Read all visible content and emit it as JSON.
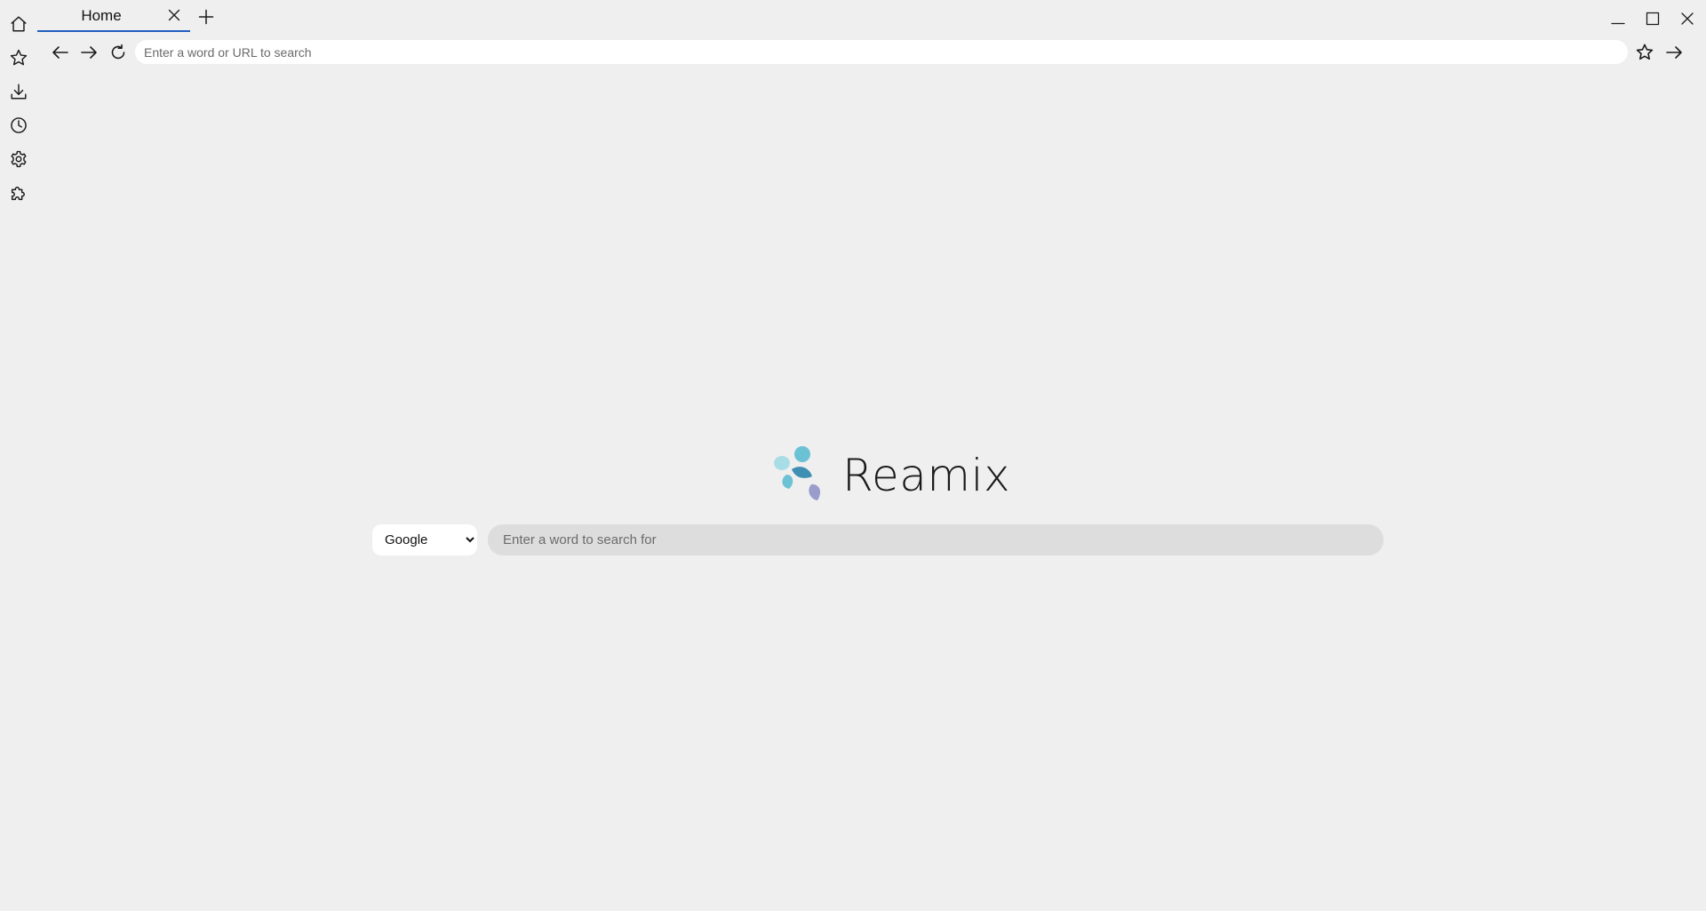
{
  "sidebar": {
    "items": [
      {
        "icon": "home-icon"
      },
      {
        "icon": "star-icon"
      },
      {
        "icon": "download-icon"
      },
      {
        "icon": "history-icon"
      },
      {
        "icon": "gear-icon"
      },
      {
        "icon": "puzzle-icon"
      }
    ]
  },
  "tabs": [
    {
      "title": "Home",
      "active": true
    }
  ],
  "toolbar": {
    "address_placeholder": "Enter a word or URL to search",
    "address_value": ""
  },
  "home": {
    "brand": "Reamix",
    "engine": {
      "selected": "Google",
      "options": [
        "Google"
      ]
    },
    "search_placeholder": "Enter a word to search for",
    "search_value": ""
  },
  "colors": {
    "background": "#efefef",
    "tab_underline": "#1f5fbf",
    "search_field": "#dddddd",
    "logo_light": "#a9dde6",
    "logo_teal": "#6cc2d5",
    "logo_blue": "#3f8fb3",
    "logo_purple": "#9a9ccc"
  }
}
